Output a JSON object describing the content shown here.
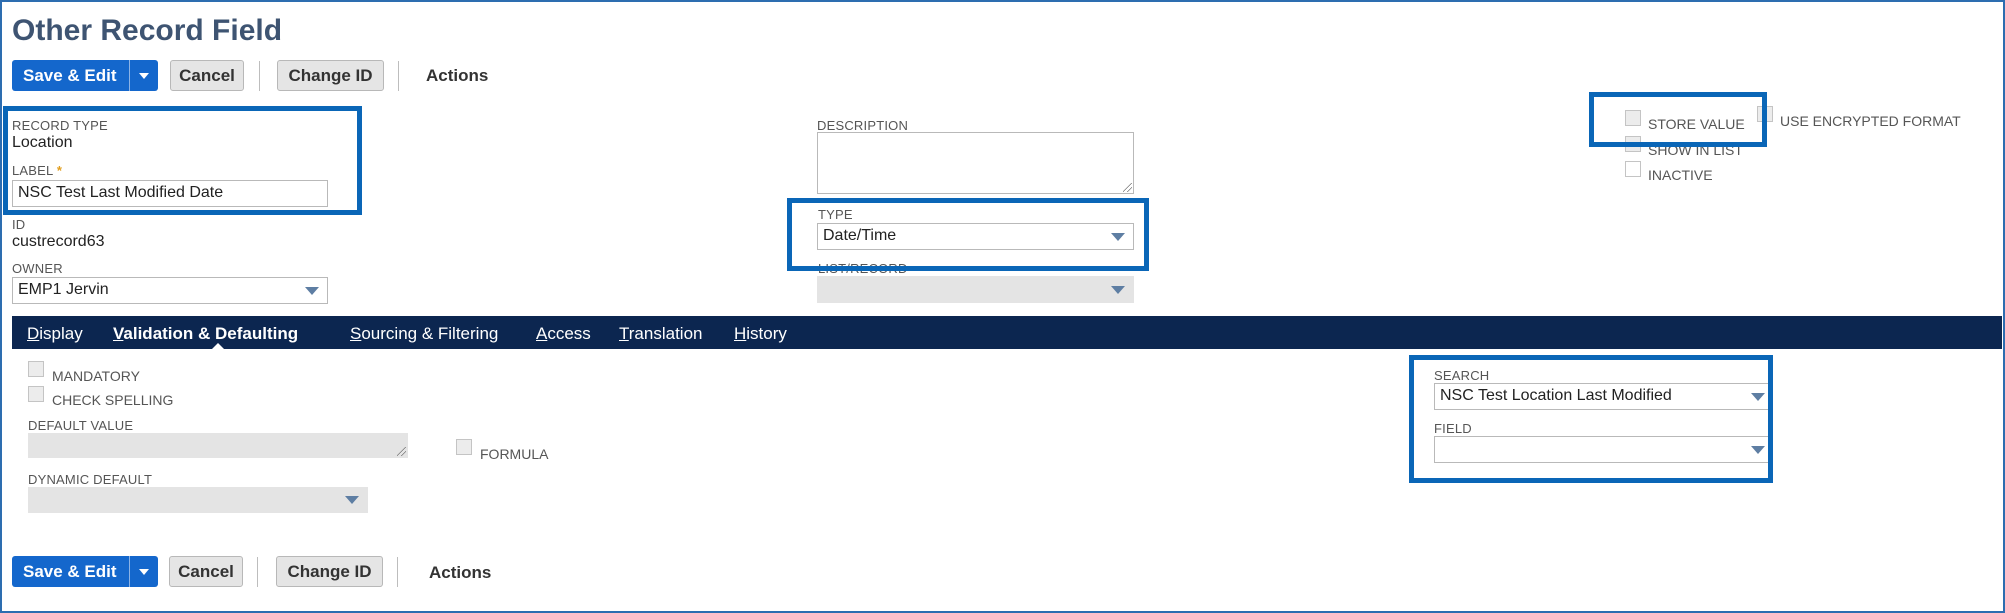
{
  "page": {
    "title": "Other Record Field"
  },
  "toolbar": {
    "save_edit": "Save & Edit",
    "cancel": "Cancel",
    "change_id": "Change ID",
    "actions": "Actions"
  },
  "fields": {
    "record_type": {
      "label": "RECORD TYPE",
      "value": "Location"
    },
    "label": {
      "label": "LABEL",
      "required_mark": "*",
      "value": "NSC Test Last Modified Date"
    },
    "id": {
      "label": "ID",
      "value": "custrecord63"
    },
    "owner": {
      "label": "OWNER",
      "value": "EMP1 Jervin"
    },
    "description": {
      "label": "DESCRIPTION",
      "value": ""
    },
    "type": {
      "label": "TYPE",
      "value": "Date/Time"
    },
    "list_record": {
      "label": "LIST/RECORD",
      "value": ""
    }
  },
  "checkboxes_top": [
    {
      "label": "STORE VALUE",
      "checked": false
    },
    {
      "label": "USE ENCRYPTED FORMAT",
      "checked": false
    },
    {
      "label": "SHOW IN LIST",
      "checked": false
    },
    {
      "label": "INACTIVE",
      "checked": false
    }
  ],
  "tabs": [
    {
      "label": "Display",
      "underline": "D",
      "rest": "isplay",
      "active": false
    },
    {
      "label": "Validation & Defaulting",
      "underline": "V",
      "rest": "alidation & Defaulting",
      "active": true
    },
    {
      "label": "Sourcing & Filtering",
      "underline": "S",
      "rest": "ourcing & Filtering",
      "active": false
    },
    {
      "label": "Access",
      "underline": "A",
      "rest": "ccess",
      "active": false
    },
    {
      "label": "Translation",
      "underline": "T",
      "rest": "ranslation",
      "active": false
    },
    {
      "label": "History",
      "underline": "H",
      "rest": "istory",
      "active": false
    }
  ],
  "validation": {
    "mandatory": "MANDATORY",
    "check_spelling": "CHECK SPELLING",
    "default_value": "DEFAULT VALUE",
    "formula": "FORMULA",
    "dynamic_default": "DYNAMIC DEFAULT",
    "search": {
      "label": "SEARCH",
      "value": "NSC Test Location Last Modified"
    },
    "field": {
      "label": "FIELD",
      "value": ""
    }
  },
  "colors": {
    "primary_button": "#1467cc",
    "tab_bar": "#0c2650",
    "highlight_box": "#0a66b7",
    "title": "#3e5472"
  }
}
